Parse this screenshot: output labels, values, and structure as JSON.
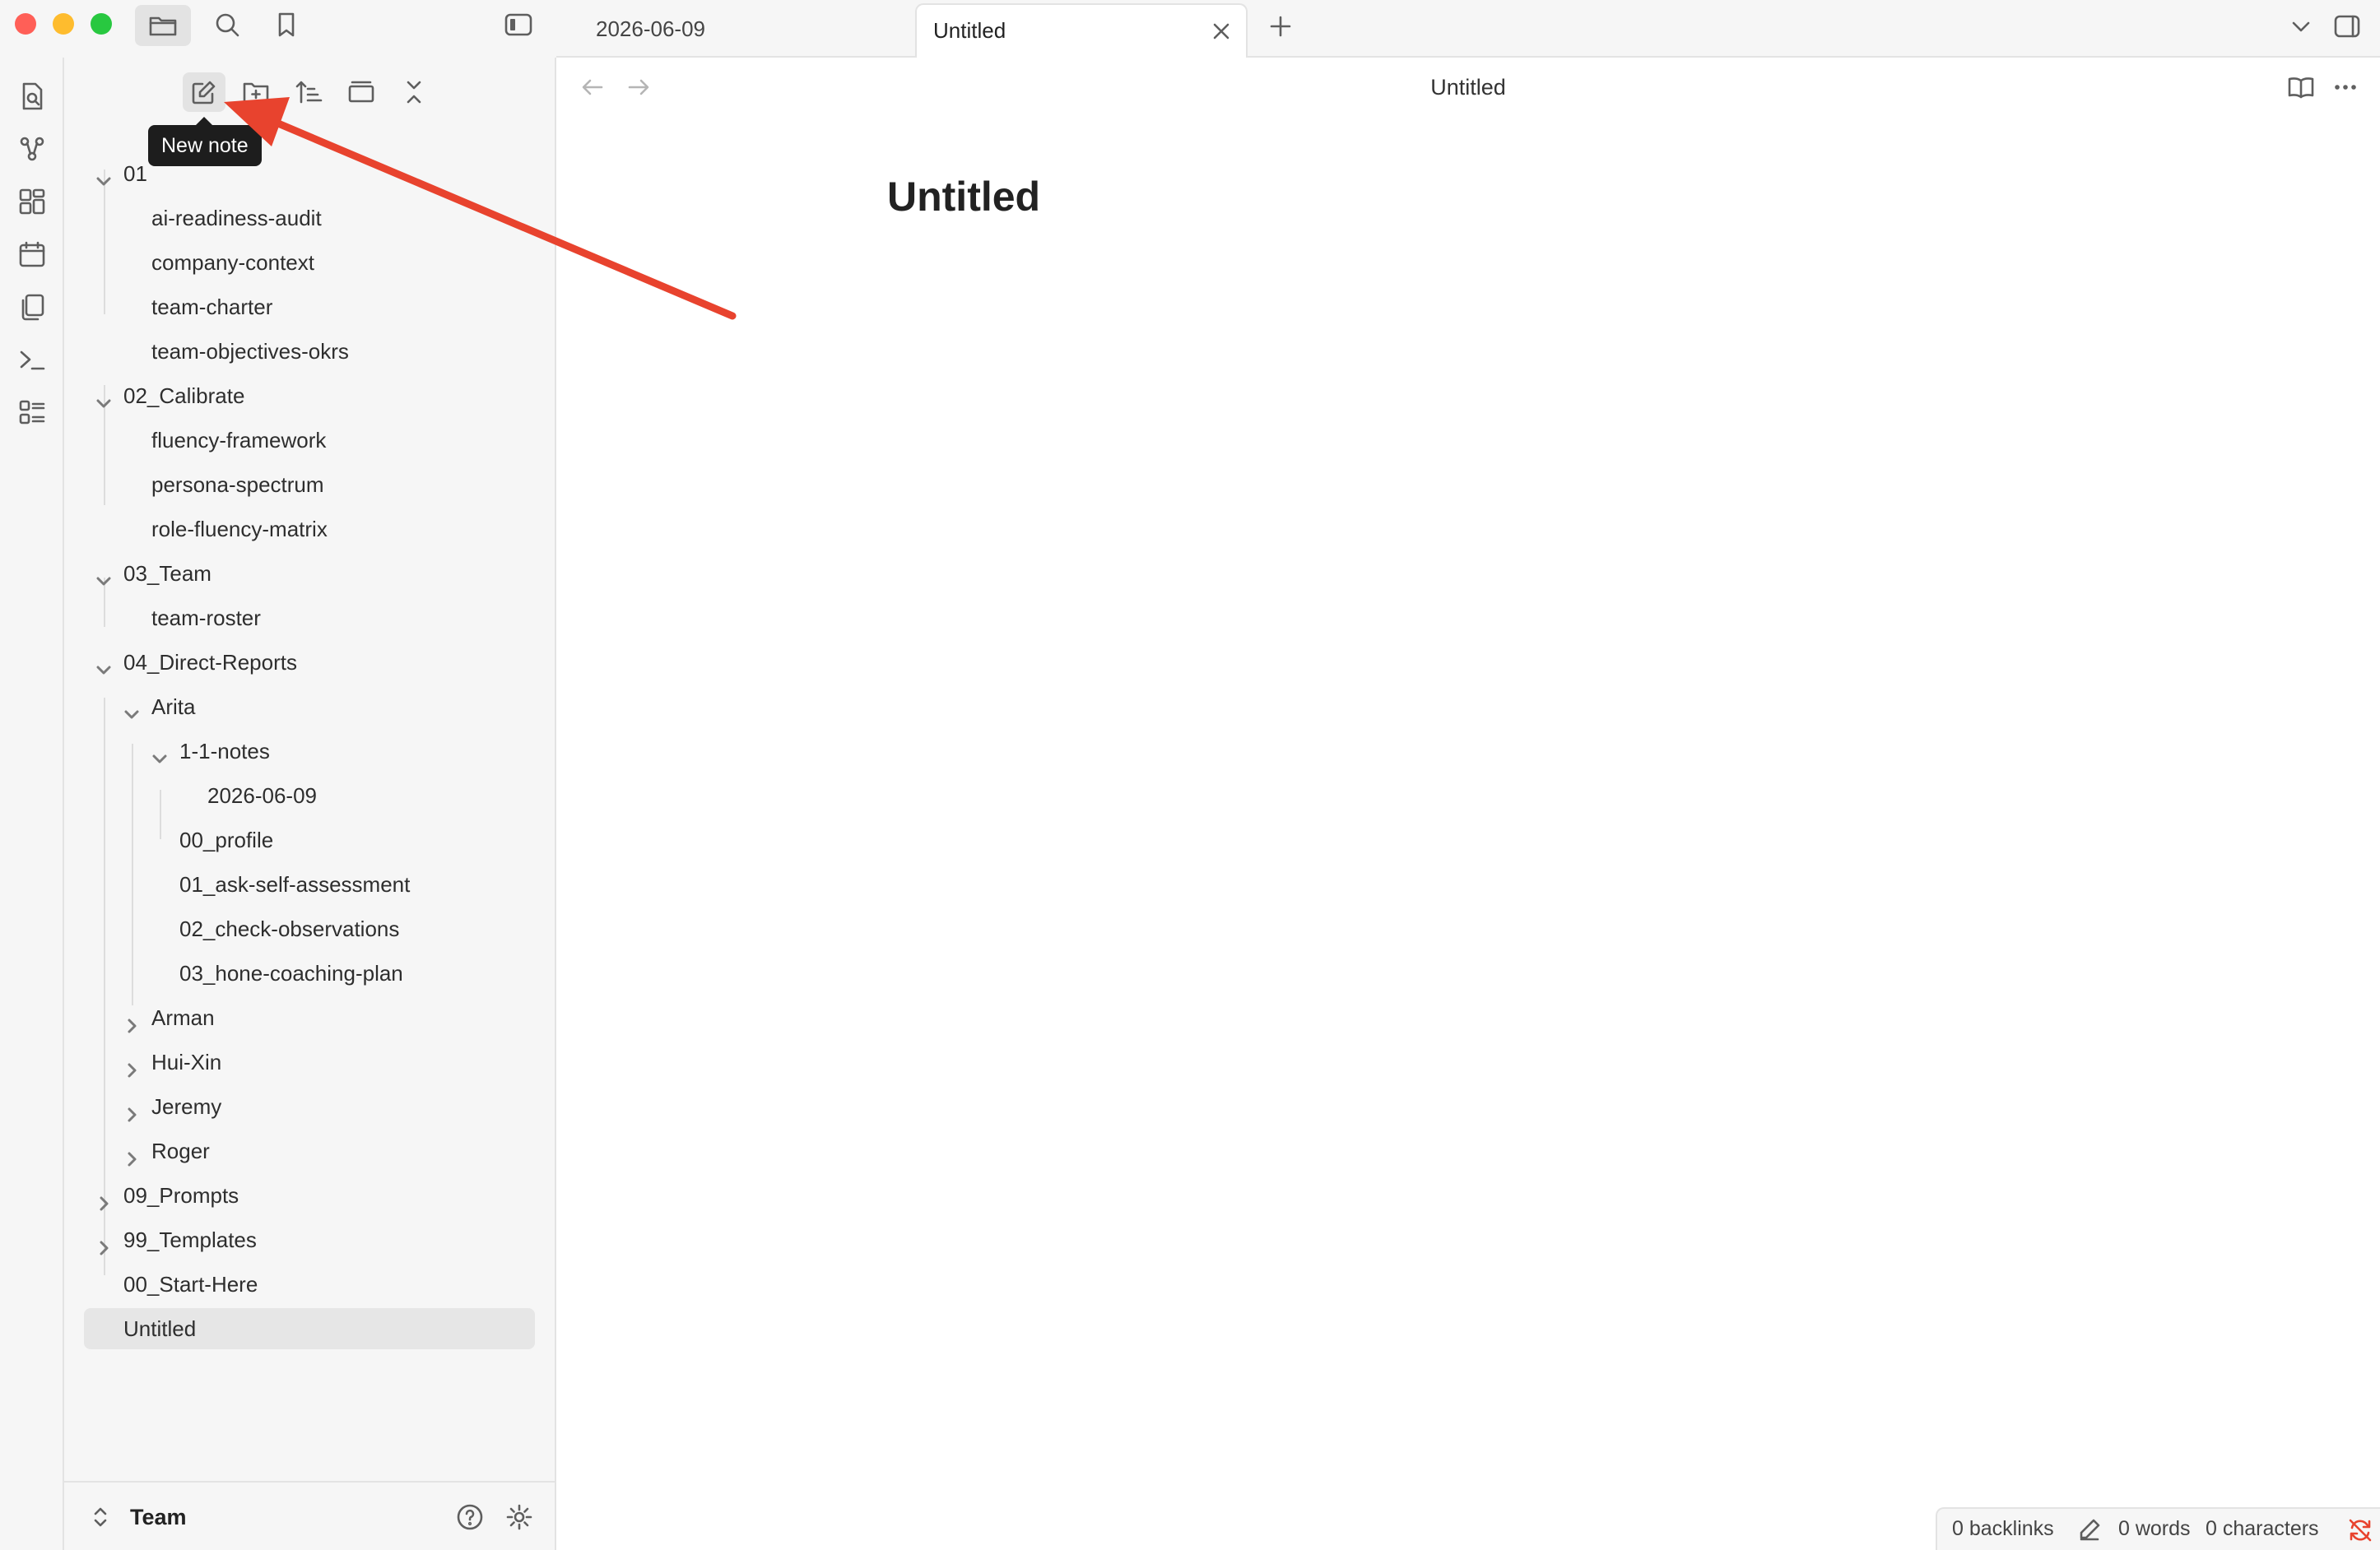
{
  "window": {
    "traffic_lights": {
      "close": "#ff5f57",
      "minimize": "#febc2e",
      "zoom": "#28c840"
    }
  },
  "titlebar": {
    "icons": [
      "folder-icon",
      "search-icon",
      "bookmark-icon",
      "sidebar-toggle-icon"
    ]
  },
  "ribbon": {
    "icons": [
      "quick-switcher-icon",
      "graph-view-icon",
      "canvas-icon",
      "calendar-icon",
      "templates-icon",
      "command-palette-icon",
      "bases-icon"
    ]
  },
  "file_explorer": {
    "toolbar_icons": [
      "new-note-icon",
      "new-folder-icon",
      "sort-icon",
      "auto-reveal-icon",
      "collapse-all-icon"
    ],
    "tooltip": "New note",
    "tree": [
      {
        "label": "01",
        "level": 0,
        "type": "folder",
        "expanded": true
      },
      {
        "label": "ai-readiness-audit",
        "level": 1,
        "type": "file"
      },
      {
        "label": "company-context",
        "level": 1,
        "type": "file"
      },
      {
        "label": "team-charter",
        "level": 1,
        "type": "file"
      },
      {
        "label": "team-objectives-okrs",
        "level": 1,
        "type": "file"
      },
      {
        "label": "02_Calibrate",
        "level": 0,
        "type": "folder",
        "expanded": true
      },
      {
        "label": "fluency-framework",
        "level": 1,
        "type": "file"
      },
      {
        "label": "persona-spectrum",
        "level": 1,
        "type": "file"
      },
      {
        "label": "role-fluency-matrix",
        "level": 1,
        "type": "file"
      },
      {
        "label": "03_Team",
        "level": 0,
        "type": "folder",
        "expanded": true
      },
      {
        "label": "team-roster",
        "level": 1,
        "type": "file"
      },
      {
        "label": "04_Direct-Reports",
        "level": 0,
        "type": "folder",
        "expanded": true
      },
      {
        "label": "Arita",
        "level": 1,
        "type": "folder",
        "expanded": true
      },
      {
        "label": "1-1-notes",
        "level": 2,
        "type": "folder",
        "expanded": true
      },
      {
        "label": "2026-06-09",
        "level": 3,
        "type": "file"
      },
      {
        "label": "00_profile",
        "level": 2,
        "type": "file"
      },
      {
        "label": "01_ask-self-assessment",
        "level": 2,
        "type": "file"
      },
      {
        "label": "02_check-observations",
        "level": 2,
        "type": "file"
      },
      {
        "label": "03_hone-coaching-plan",
        "level": 2,
        "type": "file"
      },
      {
        "label": "Arman",
        "level": 1,
        "type": "folder",
        "expanded": false
      },
      {
        "label": "Hui-Xin",
        "level": 1,
        "type": "folder",
        "expanded": false
      },
      {
        "label": "Jeremy",
        "level": 1,
        "type": "folder",
        "expanded": false
      },
      {
        "label": "Roger",
        "level": 1,
        "type": "folder",
        "expanded": false
      },
      {
        "label": "09_Prompts",
        "level": 0,
        "type": "folder",
        "expanded": false
      },
      {
        "label": "99_Templates",
        "level": 0,
        "type": "folder",
        "expanded": false
      },
      {
        "label": "00_Start-Here",
        "level": 0,
        "type": "file"
      },
      {
        "label": "Untitled",
        "level": 0,
        "type": "file",
        "selected": true
      }
    ],
    "vault_name": "Team"
  },
  "tabs": [
    {
      "label": "2026-06-09",
      "active": false
    },
    {
      "label": "Untitled",
      "active": true
    }
  ],
  "editor": {
    "header_title": "Untitled",
    "note_title": "Untitled"
  },
  "statusbar": {
    "backlinks": "0 backlinks",
    "words": "0 words",
    "characters": "0 characters"
  },
  "annotation": {
    "arrow_color": "#e8432e"
  }
}
